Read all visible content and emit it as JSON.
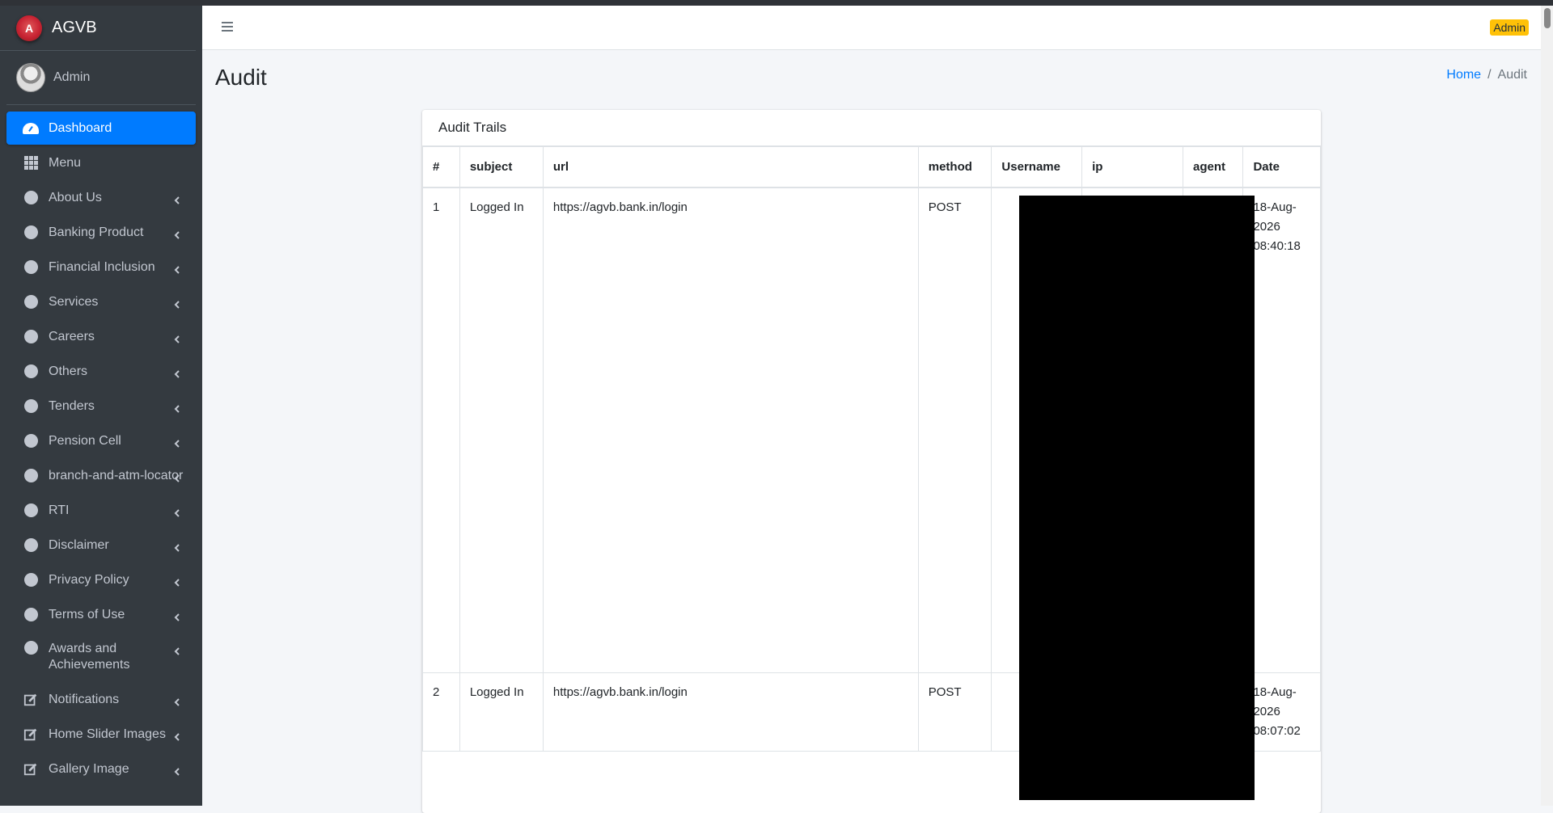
{
  "brand": {
    "name": "AGVB",
    "logo_letter": "A"
  },
  "user": {
    "name": "Admin"
  },
  "sidebar": {
    "items": [
      {
        "label": "Dashboard",
        "icon": "dashboard-icon",
        "active": true,
        "chevron": false
      },
      {
        "label": "Menu",
        "icon": "grid-icon",
        "chevron": false
      },
      {
        "label": "About Us",
        "icon": "circle-icon",
        "chevron": true
      },
      {
        "label": "Banking Product",
        "icon": "circle-icon",
        "chevron": true
      },
      {
        "label": "Financial Inclusion",
        "icon": "circle-icon",
        "chevron": true
      },
      {
        "label": "Services",
        "icon": "circle-icon",
        "chevron": true
      },
      {
        "label": "Careers",
        "icon": "circle-icon",
        "chevron": true
      },
      {
        "label": "Others",
        "icon": "circle-icon",
        "chevron": true
      },
      {
        "label": "Tenders",
        "icon": "circle-icon",
        "chevron": true
      },
      {
        "label": "Pension Cell",
        "icon": "circle-icon",
        "chevron": true
      },
      {
        "label": "branch-and-atm-locator",
        "icon": "circle-icon",
        "chevron": true
      },
      {
        "label": "RTI",
        "icon": "circle-icon",
        "chevron": true
      },
      {
        "label": "Disclaimer",
        "icon": "circle-icon",
        "chevron": true
      },
      {
        "label": "Privacy Policy",
        "icon": "circle-icon",
        "chevron": true
      },
      {
        "label": "Terms of Use",
        "icon": "circle-icon",
        "chevron": true
      },
      {
        "label": "Awards and Achievements",
        "icon": "circle-icon",
        "chevron": true
      },
      {
        "label": "Notifications",
        "icon": "edit-icon",
        "chevron": true
      },
      {
        "label": "Home Slider Images",
        "icon": "edit-icon",
        "chevron": true
      },
      {
        "label": "Gallery Image",
        "icon": "edit-icon",
        "chevron": true
      }
    ]
  },
  "header": {
    "admin_badge": "Admin"
  },
  "page": {
    "title": "Audit"
  },
  "breadcrumb": {
    "home": "Home",
    "current": "Audit"
  },
  "card": {
    "title": "Audit Trails"
  },
  "table": {
    "columns": [
      "#",
      "subject",
      "url",
      "method",
      "Username",
      "ip",
      "agent",
      "Date"
    ],
    "rows": [
      {
        "num": "1",
        "subject": "Logged In",
        "url": "https://agvb.bank.in/login",
        "method": "POST",
        "date_line1": "18-Aug-",
        "date_line2": "2026",
        "date_line3": "08:40:18"
      },
      {
        "num": "2",
        "subject": "Logged In",
        "url": "https://agvb.bank.in/login",
        "method": "POST",
        "date_line1": "18-Aug-",
        "date_line2": "2026",
        "date_line3": "08:07:02"
      }
    ]
  },
  "colors": {
    "sidebar_bg": "#343a40",
    "active": "#007bff",
    "badge": "#ffc107",
    "redaction": "#000000"
  }
}
